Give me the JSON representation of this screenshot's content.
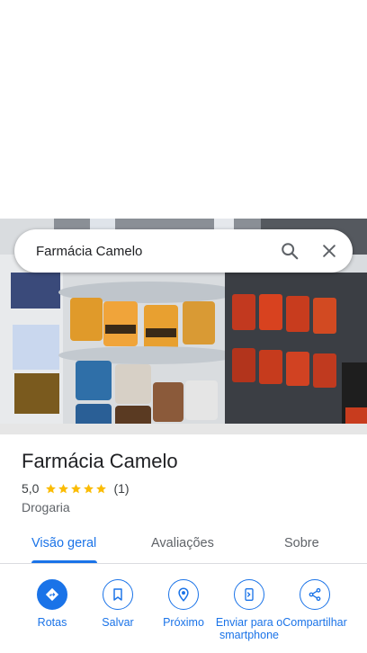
{
  "search": {
    "query": "Farmácia Camelo"
  },
  "place": {
    "name": "Farmácia Camelo",
    "rating": "5,0",
    "stars": 5,
    "review_count": "(1)",
    "category": "Drogaria"
  },
  "tabs": [
    {
      "label": "Visão geral",
      "active": true
    },
    {
      "label": "Avaliações",
      "active": false
    },
    {
      "label": "Sobre",
      "active": false
    }
  ],
  "actions": [
    {
      "label": "Rotas",
      "icon": "directions-icon"
    },
    {
      "label": "Salvar",
      "icon": "bookmark-icon"
    },
    {
      "label": "Próximo",
      "icon": "nearby-icon"
    },
    {
      "label": "Enviar para o smartphone",
      "icon": "send-to-phone-icon"
    },
    {
      "label": "Compartilhar",
      "icon": "share-icon"
    }
  ],
  "colors": {
    "accent": "#1a73e8",
    "star": "#fbbc04",
    "text_primary": "#202124",
    "text_secondary": "#5f6368"
  }
}
